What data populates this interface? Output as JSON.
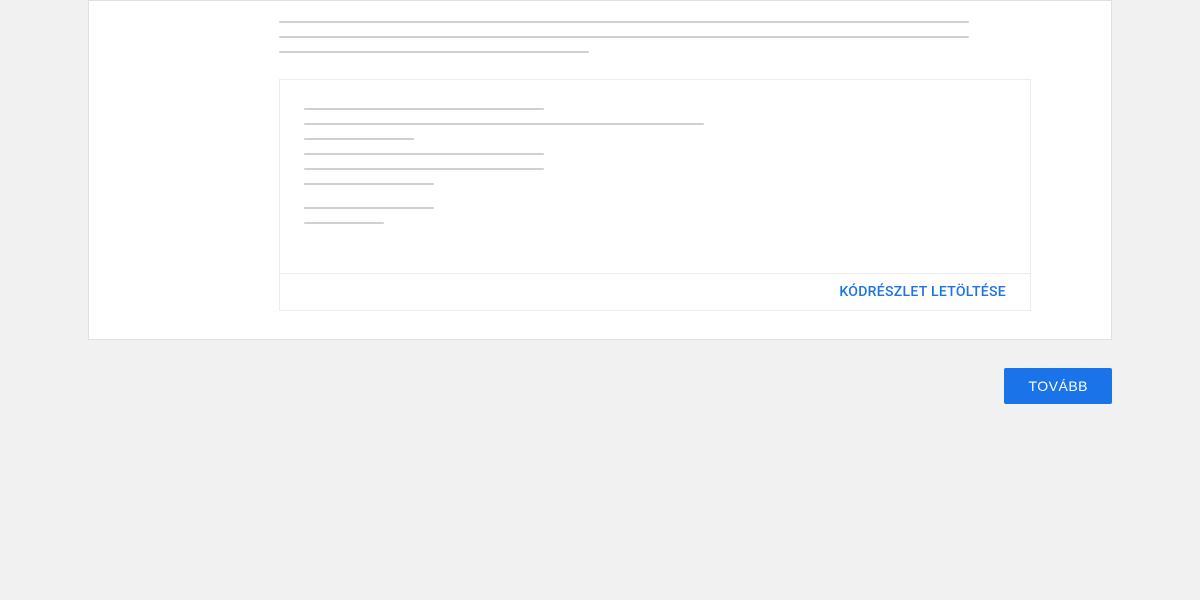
{
  "code_box": {
    "download_label": "KÓDRÉSZLET LETÖLTÉSE"
  },
  "actions": {
    "next_label": "TOVÁBB"
  }
}
